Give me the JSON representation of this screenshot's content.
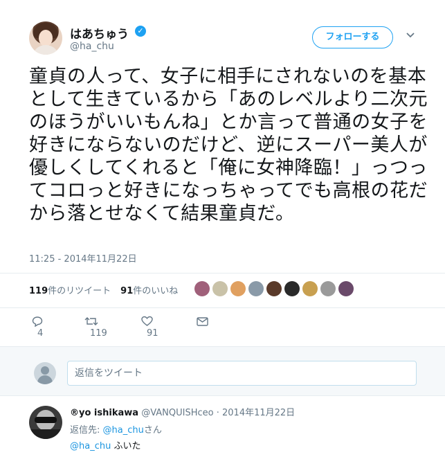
{
  "tweet": {
    "author_name": "はあちゅう",
    "author_handle": "@ha_chu",
    "follow_label": "フォローする",
    "text": "童貞の人って、女子に相手にされないのを基本として生きているから「あのレベルより二次元のほうがいいもんね」とか言って普通の女子を好きにならないのだけど、逆にスーパー美人が優しくしてくれると「俺に女神降臨！」っつってコロっと好きになっちゃってでも高根の花だから落とせなくて結果童貞だ。",
    "timestamp": "11:25 - 2014年11月22日",
    "retweets_count": "119",
    "retweets_label": "件のリツイート",
    "likes_count": "91",
    "likes_label": "件のいいね",
    "reply_count": "4",
    "retweet_action_count": "119",
    "like_action_count": "91"
  },
  "liker_colors": [
    "#a0607a",
    "#c9c2a8",
    "#e0a060",
    "#8a9aa8",
    "#5a3a2a",
    "#2a2a2a",
    "#c8a050",
    "#9a9a9a",
    "#6a4a6a"
  ],
  "reply_box": {
    "placeholder": "返信をツイート"
  },
  "reply": {
    "name": "®yo ishikawa",
    "handle": "@VANQUISHceo",
    "separator": "·",
    "date": "2014年11月22日",
    "replying_prefix": "返信先: ",
    "replying_to": "@ha_chu",
    "replying_suffix": "さん",
    "mention": "@ha_chu",
    "text": " ふいた"
  },
  "colors": {
    "accent": "#1da1f2",
    "link": "#1b95e0",
    "muted": "#657786"
  }
}
